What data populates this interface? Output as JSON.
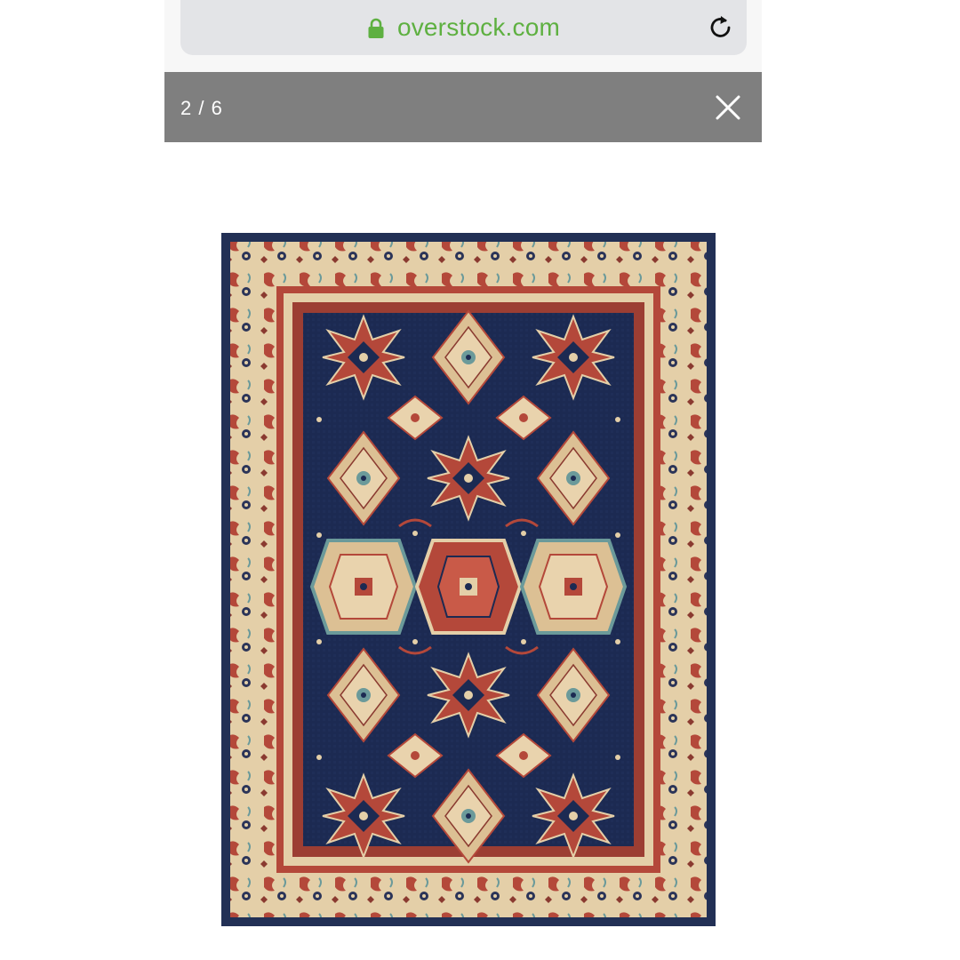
{
  "browser": {
    "url": "overstock.com",
    "lock_icon": "lock-icon",
    "reload_icon": "reload-icon",
    "url_color": "#5eb041"
  },
  "viewer": {
    "counter": "2 / 6",
    "close_icon": "close-icon",
    "bar_color": "#7f7f7f"
  },
  "image": {
    "subject": "rug-image",
    "palette": {
      "field": "#1c2a52",
      "border_cream": "#e4cfa8",
      "red": "#b4483a",
      "tan": "#dcc094",
      "teal": "#6b9a9a",
      "outer": "#223055"
    }
  }
}
